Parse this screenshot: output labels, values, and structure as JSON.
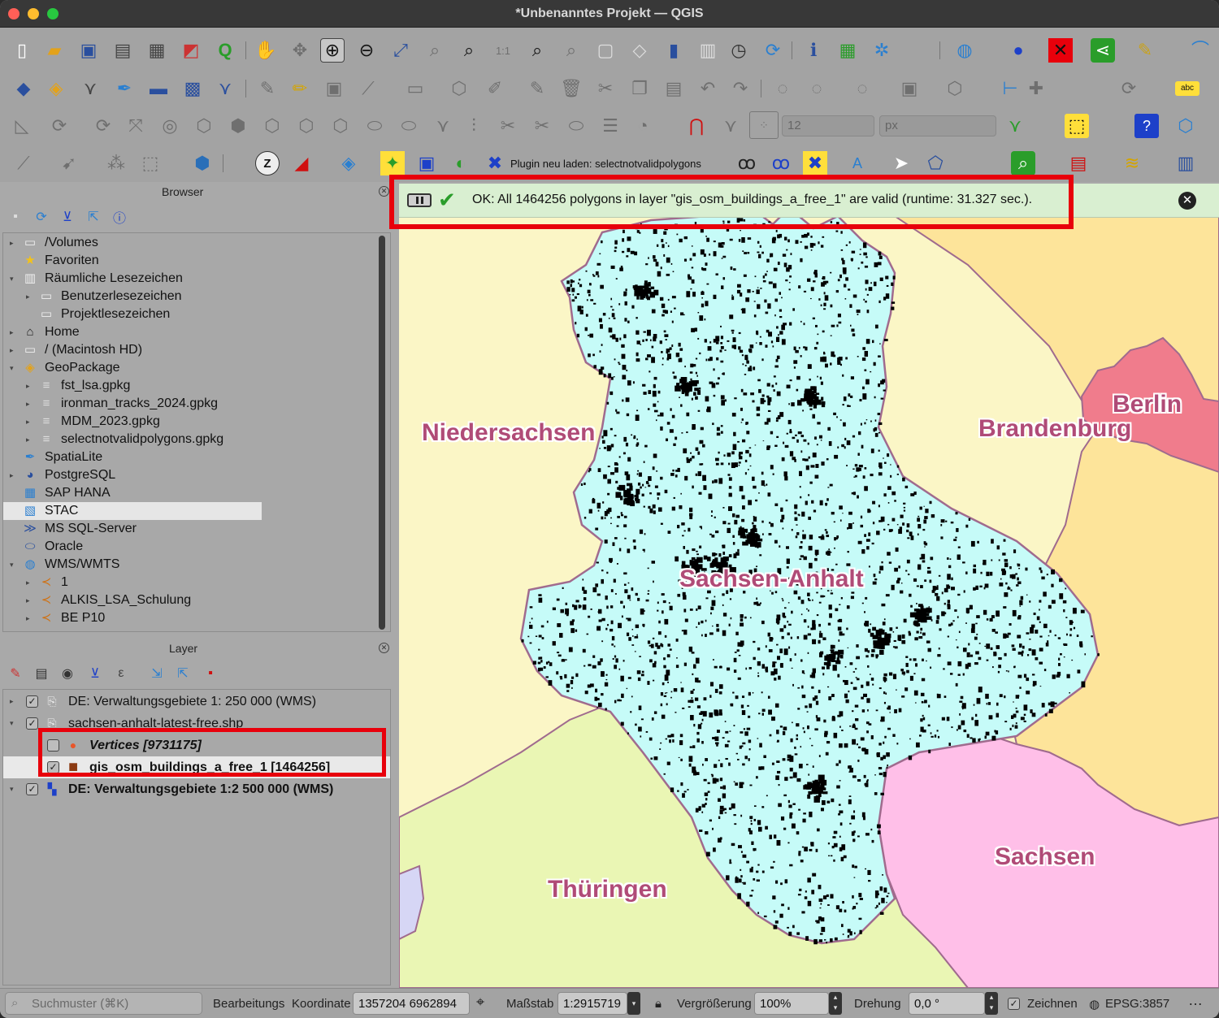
{
  "window": {
    "title": "*Unbenanntes Projekt — QGIS"
  },
  "toolbar": {
    "plugin_reload_label": "Plugin neu laden: selectnotvalidpolygons",
    "snap_tolerance": "12",
    "snap_units": "px"
  },
  "browser": {
    "title": "Browser",
    "items": [
      {
        "label": "/Volumes",
        "icon": "folder-icon",
        "indent": 0,
        "arrow": "▸"
      },
      {
        "label": "Favoriten",
        "icon": "star-icon",
        "indent": 0,
        "arrow": ""
      },
      {
        "label": "Räumliche Lesezeichen",
        "icon": "bookmark-icon",
        "indent": 0,
        "arrow": "▾"
      },
      {
        "label": "Benutzerlesezeichen",
        "icon": "folder-icon",
        "indent": 1,
        "arrow": "▸"
      },
      {
        "label": "Projektlesezeichen",
        "icon": "folder-icon",
        "indent": 1,
        "arrow": ""
      },
      {
        "label": "Home",
        "icon": "home-icon",
        "indent": 0,
        "arrow": "▸"
      },
      {
        "label": "/ (Macintosh HD)",
        "icon": "folder-icon",
        "indent": 0,
        "arrow": "▸"
      },
      {
        "label": "GeoPackage",
        "icon": "geopackage-icon",
        "indent": 0,
        "arrow": "▾"
      },
      {
        "label": "fst_lsa.gpkg",
        "icon": "database-icon",
        "indent": 1,
        "arrow": "▸"
      },
      {
        "label": "ironman_tracks_2024.gpkg",
        "icon": "database-icon",
        "indent": 1,
        "arrow": "▸"
      },
      {
        "label": "MDM_2023.gpkg",
        "icon": "database-icon",
        "indent": 1,
        "arrow": "▸"
      },
      {
        "label": "selectnotvalidpolygons.gpkg",
        "icon": "database-icon",
        "indent": 1,
        "arrow": "▸"
      },
      {
        "label": "SpatiaLite",
        "icon": "feather-icon",
        "indent": 0,
        "arrow": ""
      },
      {
        "label": "PostgreSQL",
        "icon": "elephant-icon",
        "indent": 0,
        "arrow": "▸"
      },
      {
        "label": "SAP HANA",
        "icon": "grid-icon",
        "indent": 0,
        "arrow": ""
      },
      {
        "label": "STAC",
        "icon": "stac-icon",
        "indent": 0,
        "arrow": "",
        "selected": true
      },
      {
        "label": "MS SQL-Server",
        "icon": "mssql-icon",
        "indent": 0,
        "arrow": ""
      },
      {
        "label": "Oracle",
        "icon": "oracle-icon",
        "indent": 0,
        "arrow": ""
      },
      {
        "label": "WMS/WMTS",
        "icon": "globe-icon",
        "indent": 0,
        "arrow": "▾"
      },
      {
        "label": "1",
        "icon": "wms-connection-icon",
        "indent": 1,
        "arrow": "▸"
      },
      {
        "label": "ALKIS_LSA_Schulung",
        "icon": "wms-connection-icon",
        "indent": 1,
        "arrow": "▸"
      },
      {
        "label": "BE P10",
        "icon": "wms-connection-icon",
        "indent": 1,
        "arrow": "▸"
      }
    ]
  },
  "layers": {
    "title": "Layer",
    "items": [
      {
        "label": "DE: Verwaltungsgebiete 1: 250 000 (WMS)",
        "checked": true,
        "arrow": "▸",
        "indent": 0,
        "icon": "wms-layer-icon",
        "style": "normal"
      },
      {
        "label": "sachsen-anhalt-latest-free.shp",
        "checked": true,
        "arrow": "▾",
        "indent": 0,
        "icon": "group-icon",
        "style": "normal"
      },
      {
        "label": "Vertices [9731175]",
        "checked": false,
        "arrow": "",
        "indent": 1,
        "icon": "point-layer-icon",
        "style": "italic"
      },
      {
        "label": "gis_osm_buildings_a_free_1 [1464256]",
        "checked": true,
        "arrow": "",
        "indent": 1,
        "icon": "polygon-layer-icon",
        "style": "bold"
      },
      {
        "label": "DE: Verwaltungsgebiete 1:2 500 000 (WMS)",
        "checked": true,
        "arrow": "▾",
        "indent": 0,
        "icon": "wms-checker-icon",
        "style": "bold"
      }
    ]
  },
  "message_bar": {
    "text": "OK: All 1464256 polygons in layer \"gis_osm_buildings_a_free_1\" are valid (runtime: 31.327 sec.)."
  },
  "map": {
    "labels": {
      "niedersachsen": "Niedersachsen",
      "brandenburg": "Brandenburg",
      "berlin": "Berlin",
      "sachsen_anhalt": "Sachsen-Anhalt",
      "thueringen": "Thüringen",
      "sachsen": "Sachsen"
    },
    "colors": {
      "niedersachsen": "#fbf6c6",
      "brandenburg": "#fde49a",
      "berlin": "#f07c8c",
      "sachsen_anhalt": "#c6fbf8",
      "thueringen": "#eaf6b4",
      "sachsen": "#ffbfe8",
      "hessen": "#d6d6f5",
      "border": "#a06b8e"
    }
  },
  "statusbar": {
    "search_placeholder": "Suchmuster (⌘K)",
    "edit_label": "Bearbeitungs",
    "coord_label": "Koordinate",
    "coord_value": "1357204  6962894",
    "scale_label": "Maßstab",
    "scale_value": "1:2915719",
    "magnify_label": "Vergrößerung",
    "magnify_value": "100%",
    "rotation_label": "Drehung",
    "rotation_value": "0,0 °",
    "render_label": "Zeichnen",
    "crs_label": "EPSG:3857"
  }
}
